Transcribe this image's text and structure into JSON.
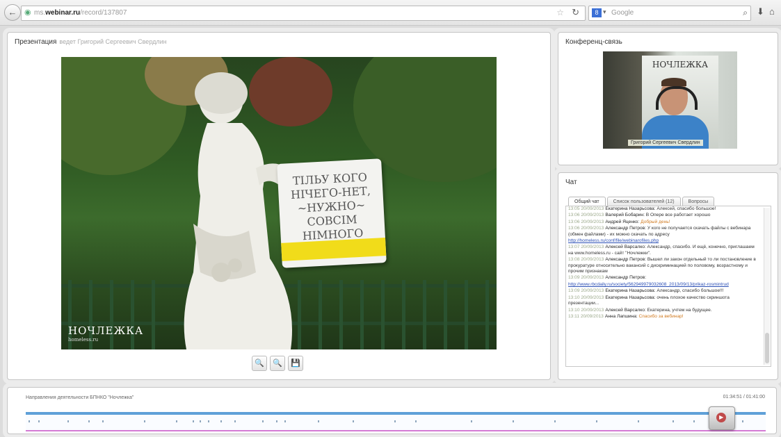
{
  "browser": {
    "back_glyph": "←",
    "url_prefix": "ms.",
    "url_domain": "webinar.ru",
    "url_path": "/record/137807",
    "search_engine_label": "8",
    "search_placeholder": "Google",
    "download_icon": "download-icon",
    "home_icon": "home-icon"
  },
  "presentation": {
    "title": "Презентация",
    "subtitle": "ведет Григорий Сергеевич Свердлин",
    "slide": {
      "sign_text": "ТІЛЬУ КОГО\nНІЧЕГО-НЕТ,\n~НУЖНО~\nСОВСІМ НІМНОГО",
      "logo": "НОЧЛЕЖКА",
      "logo_small": "homeless.ru"
    },
    "buttons": {
      "zoom_in": "🔍",
      "zoom_out": "🔍",
      "save": "💾"
    }
  },
  "conference": {
    "title": "Конференц-связь",
    "banner_text": "НОЧЛЕЖКА",
    "caption": "Григорий Сергеевич Свердлин"
  },
  "chat": {
    "title": "Чат",
    "tabs": [
      "Общий чат",
      "Список пользователей (12)",
      "Вопросы"
    ],
    "messages": [
      {
        "ts": "13:05 20/09/2013",
        "author": "Екатерина Назарьсова:",
        "text": "Алексей, спасибо большое!",
        "cls": ""
      },
      {
        "ts": "13:06 20/09/2013",
        "author": "Валерий Бобарин:",
        "text": "В Опере все работает хорошо",
        "cls": ""
      },
      {
        "ts": "13:06 20/09/2013",
        "author": "Андрей Яценко:",
        "text": "Добрый день!",
        "cls": "orange"
      },
      {
        "ts": "13:06 20/09/2013",
        "author": "Александр Петров:",
        "text": "У кого не получается скачать файлы с вебинара (обмен файлами) - их можно скачать по адресу",
        "cls": ""
      },
      {
        "ts": "",
        "author": "",
        "text": "http://homeless.ru/conf/file/webinarofiles.php",
        "cls": "link"
      },
      {
        "ts": "13:07 20/09/2013",
        "author": "Алексей Варсалко:",
        "text": "Александр, спасибо. И ещё, конечно, приглашаем на www.homeless.ru - сайт \"Ночлежки\".",
        "cls": ""
      },
      {
        "ts": "13:08 20/09/2013",
        "author": "Александр Петров:",
        "text": "Вышел ли закон отдельный то ли постановление в прокуратуре относительно вакансий с дискриминацией по половому, возрастному и прочим признакам",
        "cls": ""
      },
      {
        "ts": "13:09 20/09/2013",
        "author": "Александр Петров:",
        "text": "",
        "cls": ""
      },
      {
        "ts": "",
        "author": "",
        "text": "http://www.rbcdaily.ru/society/562949979032608_2013/09/13/prikaz-rosmintrud",
        "cls": "link"
      },
      {
        "ts": "13:09 20/09/2013",
        "author": "Екатерина Назарьсова:",
        "text": "Александр, спасибо большое!!!",
        "cls": ""
      },
      {
        "ts": "13:10 20/09/2013",
        "author": "Екатерина Назарьсова:",
        "text": "очень плохое качество скриншота презентации...",
        "cls": ""
      },
      {
        "ts": "13:10 20/09/2013",
        "author": "Алексей Варсалко:",
        "text": "Екатерина, учтем на будущее.",
        "cls": ""
      },
      {
        "ts": "13:11 20/09/2013",
        "author": "Анна Лапшина:",
        "text": "Спасибо за вебинар!",
        "cls": "orange"
      }
    ]
  },
  "timeline": {
    "title": "Направления деятельности БПНКО \"Ночлежка\"",
    "time": "01:34:51 / 01:41:00",
    "progress": 0.94,
    "play_glyph": "▶"
  }
}
